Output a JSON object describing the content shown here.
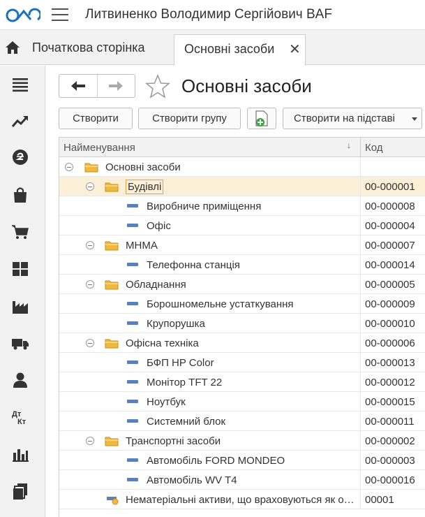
{
  "app": {
    "title": "Литвиненко Володимир Сергійович BAF"
  },
  "tabs": {
    "home_label": "Початкова сторінка",
    "active_label": "Основні засоби",
    "close_symbol": "✕"
  },
  "sidebar": {
    "icons": [
      "menu-icon",
      "trend-icon",
      "currency-icon",
      "bag-icon",
      "cart-icon",
      "grid-icon",
      "factory-icon",
      "truck-icon",
      "person-icon",
      "debit-credit-icon",
      "bar-chart-icon",
      "documents-icon"
    ]
  },
  "page": {
    "title": "Основні засоби"
  },
  "toolbar": {
    "create_label": "Створити",
    "create_group_label": "Створити групу",
    "create_on_basis_label": "Створити на підставі"
  },
  "table": {
    "columns": {
      "name": "Найменування",
      "code": "Код",
      "sort_symbol": "↓"
    },
    "rows": [
      {
        "name": "Основні засоби",
        "code": "",
        "level": 0,
        "type": "folder"
      },
      {
        "name": "Будівлі",
        "code": "00-000001",
        "level": 1,
        "type": "folder",
        "selected": true
      },
      {
        "name": "Виробниче приміщення",
        "code": "00-000008",
        "level": 2,
        "type": "item"
      },
      {
        "name": "Офіс",
        "code": "00-000004",
        "level": 2,
        "type": "item"
      },
      {
        "name": "МНМА",
        "code": "00-000007",
        "level": 1,
        "type": "folder"
      },
      {
        "name": "Телефонна станція",
        "code": "00-000014",
        "level": 2,
        "type": "item"
      },
      {
        "name": "Обладнання",
        "code": "00-000005",
        "level": 1,
        "type": "folder"
      },
      {
        "name": "Борошномельне устаткування",
        "code": "00-000009",
        "level": 2,
        "type": "item"
      },
      {
        "name": "Крупорушка",
        "code": "00-000010",
        "level": 2,
        "type": "item"
      },
      {
        "name": "Офісна техніка",
        "code": "00-000006",
        "level": 1,
        "type": "folder"
      },
      {
        "name": "БФП HP Color",
        "code": "00-000013",
        "level": 2,
        "type": "item"
      },
      {
        "name": "Монітор TFT 22",
        "code": "00-000012",
        "level": 2,
        "type": "item"
      },
      {
        "name": "Ноутбук",
        "code": "00-000015",
        "level": 2,
        "type": "item"
      },
      {
        "name": "Системний блок",
        "code": "00-000011",
        "level": 2,
        "type": "item"
      },
      {
        "name": "Транспортні засоби",
        "code": "00-000002",
        "level": 1,
        "type": "folder"
      },
      {
        "name": "Автомобіль FORD MONDEO",
        "code": "00-000003",
        "level": 2,
        "type": "item"
      },
      {
        "name": "Автомобіль WV T4",
        "code": "00-000016",
        "level": 2,
        "type": "item"
      },
      {
        "name": "Нематеріальні активи, що враховуються як основні засоби",
        "code": "00001",
        "level": 1,
        "type": "item-special"
      }
    ]
  },
  "colors": {
    "accent": "#ea8b00",
    "folder": "#f0b93a",
    "selected_row": "#fcefd8",
    "item_marker": "#5b82b8",
    "sidebar_icon": "#333333"
  }
}
